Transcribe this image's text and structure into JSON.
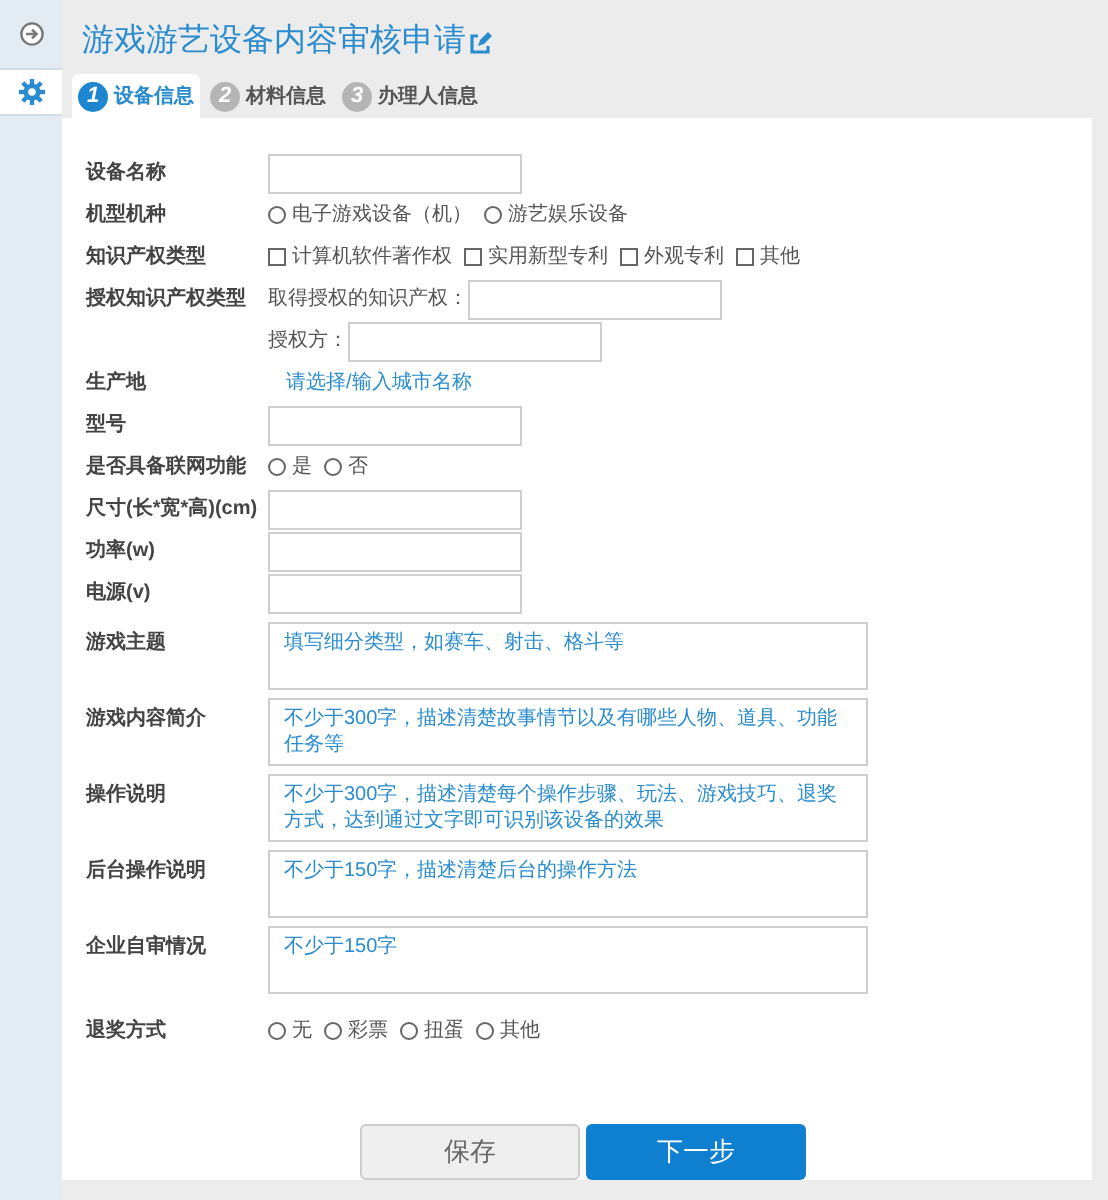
{
  "sidebar": {
    "items": [
      {
        "kind": "exit",
        "selected": false
      },
      {
        "kind": "settings",
        "selected": true
      }
    ]
  },
  "title": "游戏游艺设备内容审核申请",
  "steps": [
    {
      "number": "1",
      "label": "设备信息",
      "selected": true
    },
    {
      "number": "2",
      "label": "材料信息",
      "selected": false
    },
    {
      "number": "3",
      "label": "办理人信息",
      "selected": false
    }
  ],
  "form": {
    "fields": [
      {
        "kind": "text",
        "label": "设备名称"
      },
      {
        "kind": "radio",
        "label": "机型机种",
        "options": [
          {
            "label": "电子游戏设备（机）",
            "selected": false
          },
          {
            "label": "游艺娱乐设备",
            "selected": false
          }
        ]
      },
      {
        "kind": "checkbox",
        "label": "知识产权类型",
        "options": [
          {
            "label": "计算机软件著作权",
            "checked": false
          },
          {
            "label": "实用新型专利",
            "checked": false
          },
          {
            "label": "外观专利",
            "checked": false
          },
          {
            "label": "其他",
            "checked": false
          }
        ]
      },
      {
        "kind": "auth",
        "label": "授权知识产权类型",
        "subfields": [
          {
            "label": "取得授权的知识产权："
          },
          {
            "label": "授权方："
          }
        ]
      },
      {
        "kind": "city",
        "label": "生产地",
        "placeholder": "请选择/输入城市名称"
      },
      {
        "kind": "text",
        "label": "型号"
      },
      {
        "kind": "radio",
        "label": "是否具备联网功能",
        "options": [
          {
            "label": "是",
            "selected": false
          },
          {
            "label": "否",
            "selected": false
          }
        ]
      },
      {
        "kind": "text",
        "label": "尺寸(长*宽*高)(cm)"
      },
      {
        "kind": "text",
        "label": "功率(w)"
      },
      {
        "kind": "text",
        "label": "电源(v)"
      },
      {
        "kind": "textarea",
        "label": "游戏主题",
        "placeholder": "填写细分类型，如赛车、射击、格斗等"
      },
      {
        "kind": "textarea",
        "label": "游戏内容简介",
        "placeholder": "不少于300字，描述清楚故事情节以及有哪些人物、道具、功能任务等"
      },
      {
        "kind": "textarea",
        "label": "操作说明",
        "placeholder": "不少于300字，描述清楚每个操作步骤、玩法、游戏技巧、退奖方式，达到通过文字即可识别该设备的效果"
      },
      {
        "kind": "textarea",
        "label": "后台操作说明",
        "placeholder": "不少于150字，描述清楚后台的操作方法"
      },
      {
        "kind": "textarea",
        "label": "企业自审情况",
        "placeholder": "不少于150字"
      },
      {
        "kind": "radio",
        "label": "退奖方式",
        "options": [
          {
            "label": "无",
            "selected": false
          },
          {
            "label": "彩票",
            "selected": false
          },
          {
            "label": "扭蛋",
            "selected": false
          },
          {
            "label": "其他",
            "selected": false
          }
        ]
      }
    ]
  },
  "buttons": [
    {
      "kind": "secondary",
      "label": "保存"
    },
    {
      "kind": "primary",
      "label": "下一步"
    }
  ]
}
